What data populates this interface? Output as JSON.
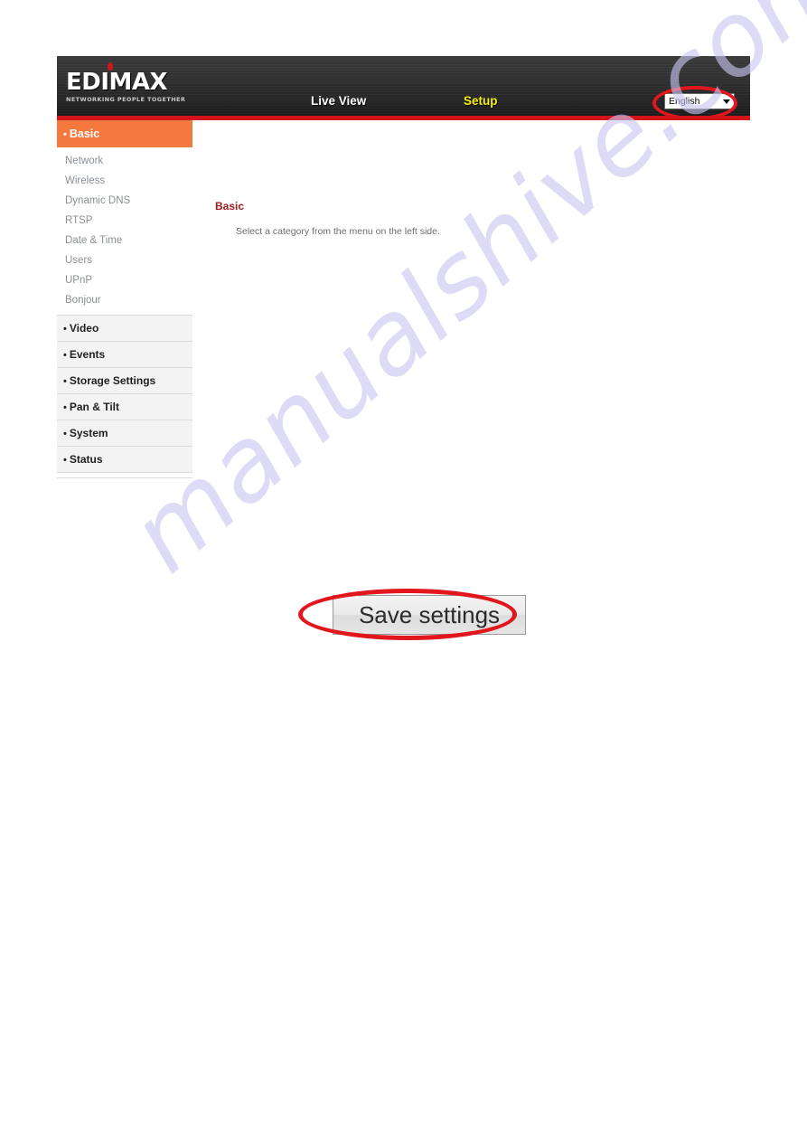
{
  "header": {
    "logo_word": "EDIMAX",
    "logo_tagline": "NETWORKING PEOPLE TOGETHER",
    "nav": {
      "live_view": "Live View",
      "setup": "Setup"
    },
    "language": {
      "selected": "English",
      "options": [
        "English"
      ]
    },
    "accent_red": "#d4141b",
    "setup_highlight_color": "#f6f000"
  },
  "sidebar": {
    "active_color": "#f4793f",
    "groups": [
      {
        "label": "Basic",
        "active": true,
        "items": [
          {
            "label": "Network"
          },
          {
            "label": "Wireless"
          },
          {
            "label": "Dynamic DNS"
          },
          {
            "label": "RTSP"
          },
          {
            "label": "Date & Time"
          },
          {
            "label": "Users"
          },
          {
            "label": "UPnP"
          },
          {
            "label": "Bonjour"
          }
        ]
      },
      {
        "label": "Video",
        "active": false,
        "items": []
      },
      {
        "label": "Events",
        "active": false,
        "items": []
      },
      {
        "label": "Storage Settings",
        "active": false,
        "items": []
      },
      {
        "label": "Pan & Tilt",
        "active": false,
        "items": []
      },
      {
        "label": "System",
        "active": false,
        "items": []
      },
      {
        "label": "Status",
        "active": false,
        "items": []
      }
    ],
    "bullet": "•"
  },
  "content": {
    "title": "Basic",
    "title_color": "#9e1b20",
    "body_text": "Select a category from the menu on the left side."
  },
  "save": {
    "label": "Save settings"
  },
  "annotations": {
    "color": "#e2161d",
    "shapes": [
      {
        "name": "language-selector-highlight",
        "shape": "ellipse"
      },
      {
        "name": "save-settings-highlight",
        "shape": "ellipse"
      }
    ]
  },
  "watermark": {
    "text": "manualshive.com",
    "color": "#c9c6f0"
  }
}
